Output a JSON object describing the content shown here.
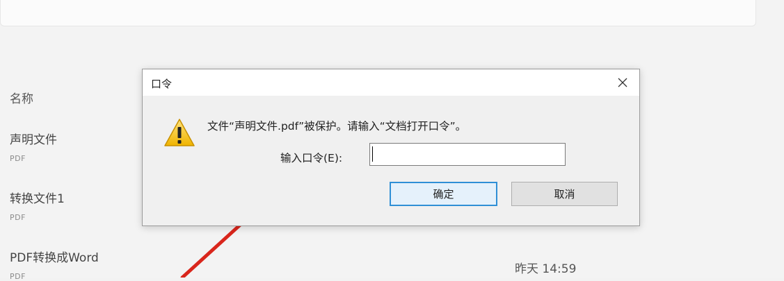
{
  "background": {
    "column_header": "名称",
    "files": [
      {
        "name": "声明文件",
        "type": "PDF"
      },
      {
        "name": "转换文件1",
        "type": "PDF"
      },
      {
        "name": "PDF转换成Word",
        "type": "PDF"
      }
    ],
    "last_file_time": "昨天 14:59"
  },
  "dialog": {
    "title": "口令",
    "close_label": "✕",
    "message": "文件“声明文件.pdf”被保护。请输入“文档打开口令”。",
    "password_label": "输入口令(E):",
    "password_value": "",
    "ok_label": "确定",
    "cancel_label": "取消",
    "icon": "warning-icon"
  },
  "colors": {
    "arrow": "#d9261c",
    "focus_border": "#2f8fd6"
  }
}
